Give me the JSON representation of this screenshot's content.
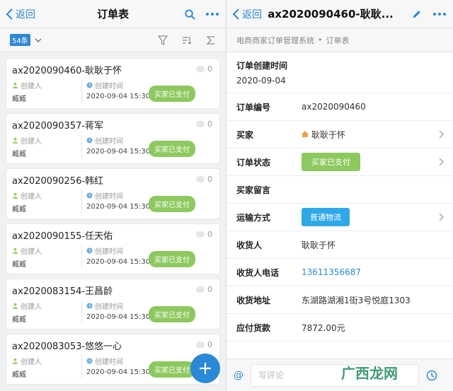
{
  "left": {
    "back_label": "返回",
    "title": "订单表",
    "count_badge": "54条",
    "cards": [
      {
        "title": "ax2020090460-耿耿于怀",
        "comments": "0",
        "creator_label": "创建人",
        "creator": "臧臧",
        "time_label": "创建时间",
        "time": "2020-09-04 15:30",
        "status": "买家已支付"
      },
      {
        "title": "ax2020090357-蒋军",
        "comments": "0",
        "creator_label": "创建人",
        "creator": "臧臧",
        "time_label": "创建时间",
        "time": "2020-09-04 15:30",
        "status": "买家已支付"
      },
      {
        "title": "ax2020090256-韩红",
        "comments": "0",
        "creator_label": "创建人",
        "creator": "臧臧",
        "time_label": "创建时间",
        "time": "2020-09-04 15:30",
        "status": "买家已支付"
      },
      {
        "title": "ax2020090155-任天佑",
        "comments": "0",
        "creator_label": "创建人",
        "creator": "臧臧",
        "time_label": "创建时间",
        "time": "2020-09-04 15:30",
        "status": "买家已支付"
      },
      {
        "title": "ax2020083154-王昌龄",
        "comments": "0",
        "creator_label": "创建人",
        "creator": "臧臧",
        "time_label": "创建时间",
        "time": "2020-09-04 15:30",
        "status": "买家已支付"
      },
      {
        "title": "ax2020083053-悠悠一心",
        "comments": "0",
        "creator_label": "创建人",
        "creator": "臧臧",
        "time_label": "创建时间",
        "time": "2020-09-04 15:30",
        "status": "买家已支付"
      }
    ]
  },
  "right": {
    "back_label": "返回",
    "title": "ax2020090460-耿耿...",
    "breadcrumb": [
      "电商商家订单管理系统",
      "订单表"
    ],
    "breadcrumb_sep": "•",
    "created_label": "订单创建时间",
    "created_value": "2020-09-04",
    "fields": {
      "order_no": {
        "label": "订单编号",
        "value": "ax2020090460"
      },
      "buyer": {
        "label": "买家",
        "value": "耿耿于怀"
      },
      "status": {
        "label": "订单状态",
        "value": "买家已支付"
      },
      "message": {
        "label": "买家留言",
        "value": ""
      },
      "shipping": {
        "label": "运输方式",
        "value": "普通物流"
      },
      "receiver": {
        "label": "收货人",
        "value": "耿耿于怀"
      },
      "phone": {
        "label": "收货人电话",
        "value": "13611356687"
      },
      "address": {
        "label": "收货地址",
        "value": "东湖路湖湘1街3号悦庭1303"
      },
      "amount": {
        "label": "应付货款",
        "value": "7872.00元"
      }
    },
    "comment_at": "@",
    "comment_placeholder": "写评论",
    "watermark": "广西龙网"
  },
  "colors": {
    "accent": "#2a88d8",
    "paid_green": "#8dc95e",
    "shipping_blue": "#2fa8e8"
  }
}
